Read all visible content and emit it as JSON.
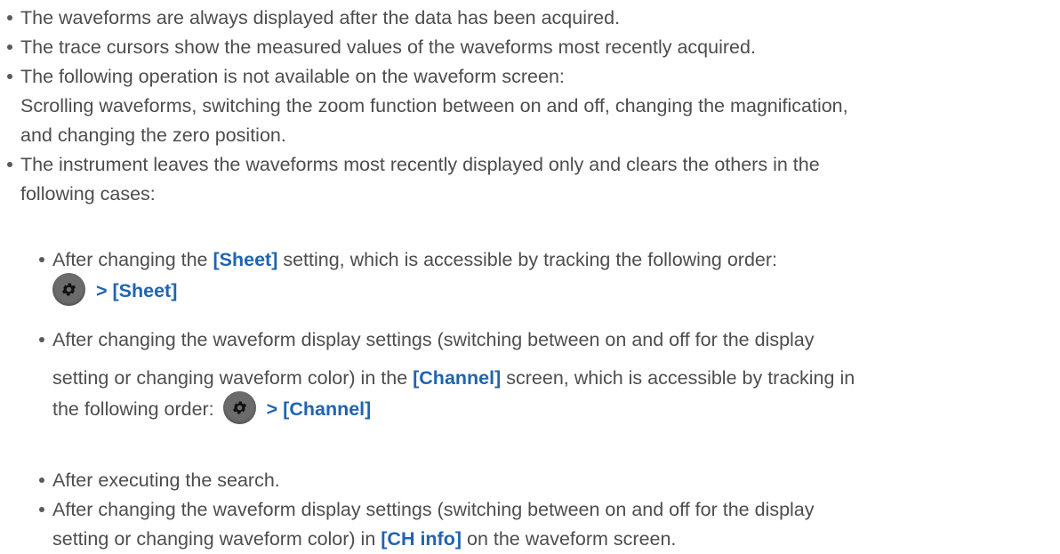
{
  "bullets": {
    "b1": "The waveforms are always displayed after the data has been acquired.",
    "b2": "The trace cursors show the measured values of the waveforms most recently acquired.",
    "b3_line1": "The following operation is not available on the waveform screen:",
    "b3_line2": "Scrolling waveforms, switching the zoom function between on and off, changing the magnification,",
    "b3_line3": "and changing the zero position.",
    "b4_line1": "The instrument leaves the waveforms most recently displayed only and clears the others in the",
    "b4_line2": "following cases:"
  },
  "cases": {
    "c1_pre": "After changing the ",
    "c1_kw": "[Sheet]",
    "c1_post": " setting, which is accessible by tracking the following order:",
    "c1_path": "> [Sheet]",
    "c2_line1": "After changing the waveform display settings (switching between on and off for the display",
    "c2_pre": "setting or changing waveform color) in the ",
    "c2_kw": "[Channel]",
    "c2_post": " screen, which is accessible by tracking in",
    "c2_line3": "the following order:",
    "c2_path": "> [Channel]",
    "c3": "After executing the search.",
    "c4_line1": "After changing the waveform display settings (switching between on and off for the display",
    "c4_pre": "setting or changing waveform color) in ",
    "c4_kw": "[CH info]",
    "c4_post": " on the waveform screen."
  },
  "icons": {
    "settings": "gear-icon"
  },
  "colors": {
    "text": "#4d4d4d",
    "keyword": "#1f64b0",
    "icon_button": "#6b6b6b"
  }
}
